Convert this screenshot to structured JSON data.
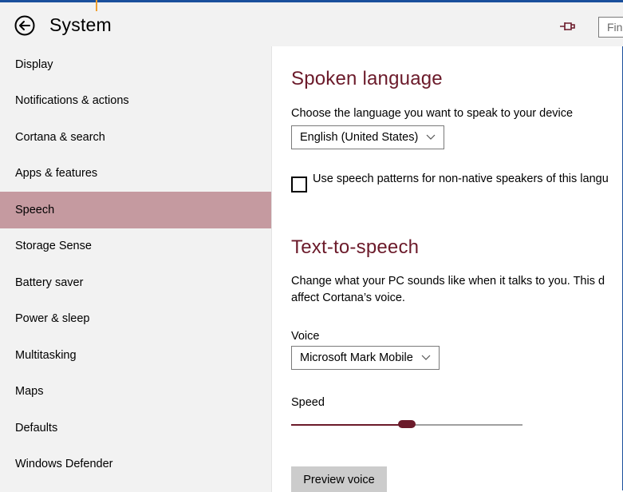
{
  "window": {
    "title": "System",
    "search_placeholder": "Fin"
  },
  "sidebar": {
    "selected_index": 4,
    "items": [
      {
        "label": "Display"
      },
      {
        "label": "Notifications & actions"
      },
      {
        "label": "Cortana & search"
      },
      {
        "label": "Apps & features"
      },
      {
        "label": "Speech"
      },
      {
        "label": "Storage Sense"
      },
      {
        "label": "Battery saver"
      },
      {
        "label": "Power & sleep"
      },
      {
        "label": "Multitasking"
      },
      {
        "label": "Maps"
      },
      {
        "label": "Defaults"
      },
      {
        "label": "Windows Defender"
      }
    ]
  },
  "spoken_language": {
    "heading": "Spoken language",
    "description": "Choose the language you want to speak to your device",
    "language_value": "English (United States)",
    "checkbox_label": "Use speech patterns for non-native speakers of this langu",
    "checkbox_checked": false
  },
  "tts": {
    "heading": "Text-to-speech",
    "description_line1": "Change what your PC sounds like when it talks to you. This d",
    "description_line2": "affect Cortana’s voice.",
    "voice_label": "Voice",
    "voice_value": "Microsoft Mark Mobile",
    "speed_label": "Speed",
    "speed_fraction": 0.5,
    "preview_button": "Preview voice"
  },
  "colors": {
    "accent": "#6b1a2a",
    "selected_item": "#c59aa0",
    "window_border": "#1a4f9c"
  },
  "icons": {
    "back": "back-arrow-circle-icon",
    "pin": "pin-icon",
    "chevron": "chevron-down-icon"
  }
}
